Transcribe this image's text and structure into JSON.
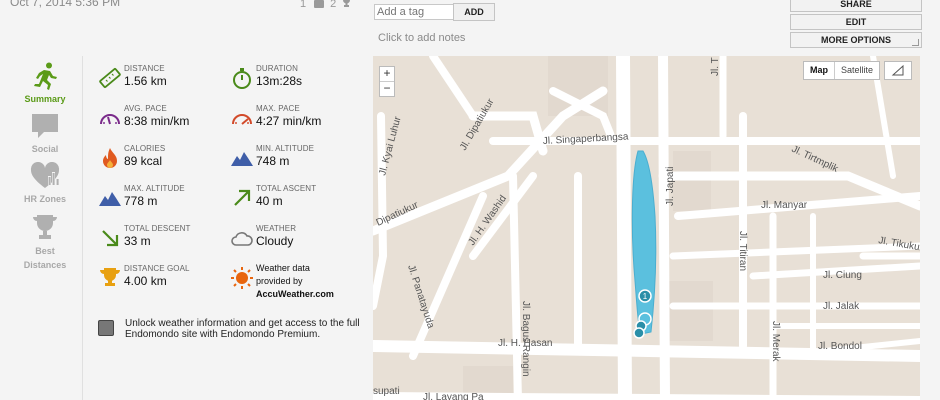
{
  "header": {
    "date": "Oct 7, 2014 5:36 PM",
    "comments_count": "1",
    "likes_count": "2",
    "tag_placeholder": "Add a tag",
    "tag_add": "ADD",
    "notes_hint": "Click to add notes",
    "share": "SHARE",
    "edit": "EDIT",
    "more_options": "MORE OPTIONS"
  },
  "nav": [
    {
      "label": "Summary",
      "icon": "running-icon",
      "active": true
    },
    {
      "label": "Social",
      "icon": "comment-icon"
    },
    {
      "label": "HR Zones",
      "icon": "heart-chart-icon"
    },
    {
      "label": "Best",
      "label2": "Distances",
      "icon": "trophy-icon"
    }
  ],
  "stats": [
    {
      "label": "DISTANCE",
      "value": "1.56 km",
      "icon": "ruler-icon"
    },
    {
      "label": "DURATION",
      "value": "13m:28s",
      "icon": "stopwatch-icon"
    },
    {
      "label": "AVG. PACE",
      "value": "8:38 min/km",
      "icon": "speedometer-icon"
    },
    {
      "label": "MAX. PACE",
      "value": "4:27 min/km",
      "icon": "speedometer-max-icon"
    },
    {
      "label": "CALORIES",
      "value": "89 kcal",
      "icon": "flame-icon"
    },
    {
      "label": "MIN. ALTITUDE",
      "value": "748 m",
      "icon": "mountain-icon"
    },
    {
      "label": "MAX. ALTITUDE",
      "value": "778 m",
      "icon": "mountain-icon"
    },
    {
      "label": "TOTAL ASCENT",
      "value": "40 m",
      "icon": "arrow-up-right-icon"
    },
    {
      "label": "TOTAL DESCENT",
      "value": "33 m",
      "icon": "arrow-down-right-icon"
    },
    {
      "label": "WEATHER",
      "value": "Cloudy",
      "icon": "cloud-icon"
    },
    {
      "label": "DISTANCE GOAL",
      "value": "4.00 km",
      "icon": "trophy-icon"
    }
  ],
  "weather_credit": {
    "line1": "Weather data",
    "line2": "provided by",
    "brand": "AccuWeather.com"
  },
  "promo": "Unlock weather information and get access to the full Endomondo site with Endomondo Premium.",
  "map": {
    "zoom_in": "+",
    "zoom_out": "−",
    "type_map": "Map",
    "type_satellite": "Satellite",
    "route_color": "#5bc0de",
    "streets": [
      "Jl. Kyai Luhur",
      "Jl. Dipatiukur",
      "Jl. Singaperbangsa",
      "Dipatiukur",
      "Jl. H. Washid",
      "Jl. Bagus Rangin",
      "Jl. Japati",
      "Jl. Titiran",
      "Jl. Manyar",
      "Jl. Tirtmplik",
      "Jl. Tikukur",
      "Jl. Ciung",
      "Jl. Jalak",
      "Jl. Bondol",
      "Jl. Merak",
      "Jl. Panatayuda",
      "Jl. H. Hasan",
      "Jl. Layang Pa",
      "supati",
      "Jl. T"
    ],
    "marker": "1"
  },
  "colors": {
    "accent": "#5b9b18",
    "icon_green": "#4a8a1a",
    "icon_blue": "#3f5ea8",
    "icon_red": "#d24a2a",
    "icon_orange": "#e07a10"
  }
}
